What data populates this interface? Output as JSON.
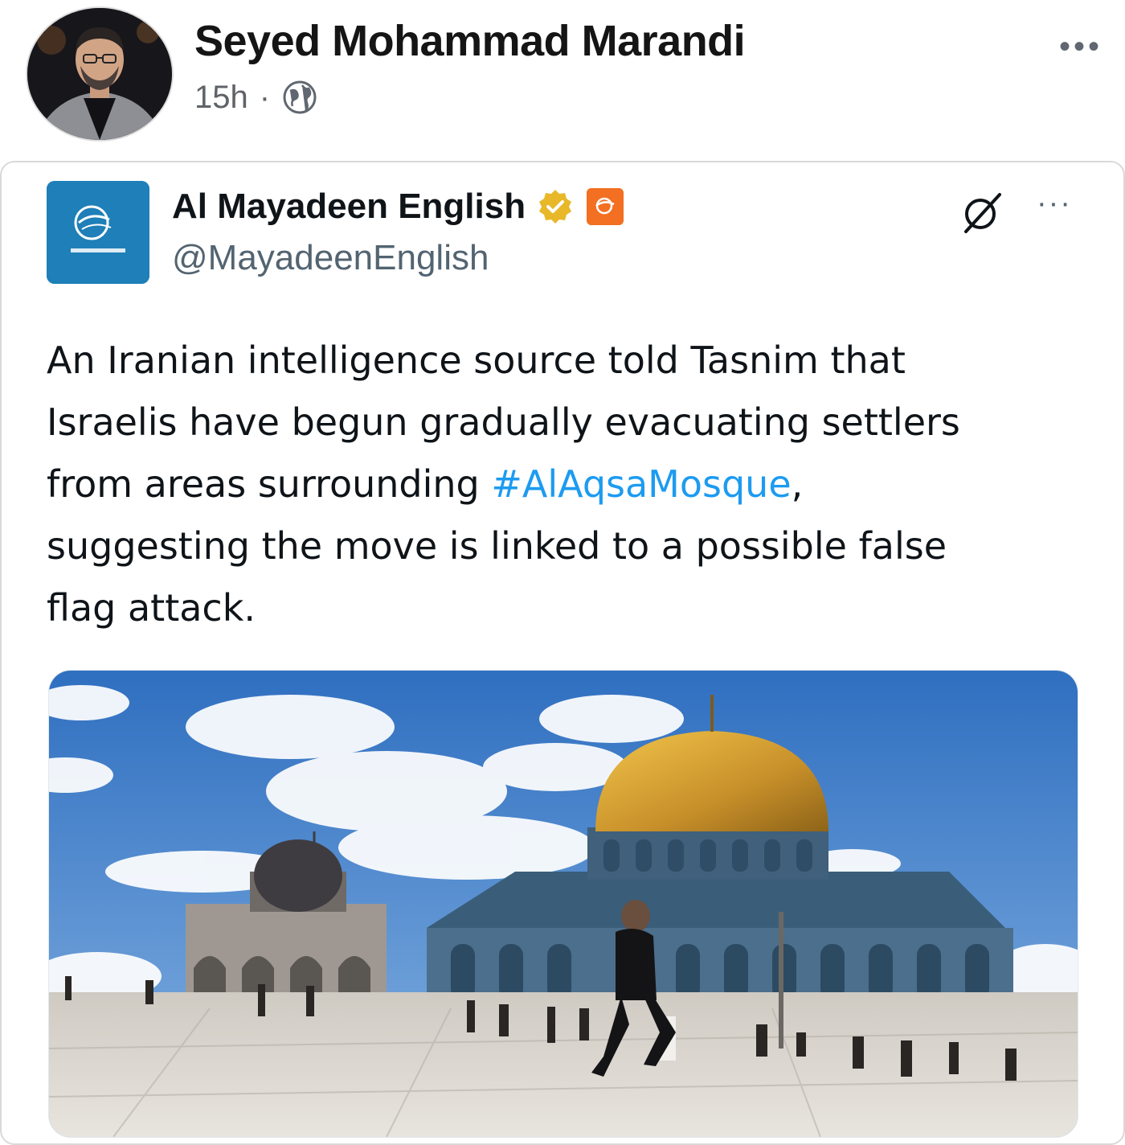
{
  "fb_post": {
    "author": "Seyed Mohammad Marandi",
    "time": "15h",
    "separator": "·",
    "privacy_icon": "globe-icon",
    "more_label": "•••"
  },
  "tweet": {
    "display_name": "Al Mayadeen English",
    "handle": "@MayadeenEnglish",
    "verified_icon": "verified-badge-icon",
    "affiliate_icon": "al-mayadeen-affiliate-icon",
    "grok_icon": "grok-icon",
    "more_label": "···",
    "text_lines": [
      "An Iranian intelligence source told Tasnim that",
      "Israelis have begun gradually evacuating settlers",
      "from areas surrounding ",
      "suggesting the move is linked to a possible false",
      "flag attack."
    ],
    "hashtag": "#AlAqsaMosque",
    "after_hashtag": ",",
    "image_subject": "dome-of-the-rock-photo"
  },
  "colors": {
    "hashtag": "#1d9bf0",
    "verified_gold": "#e8b829",
    "logo_blue": "#1f7fb8",
    "affiliate_orange": "#f36f21"
  }
}
